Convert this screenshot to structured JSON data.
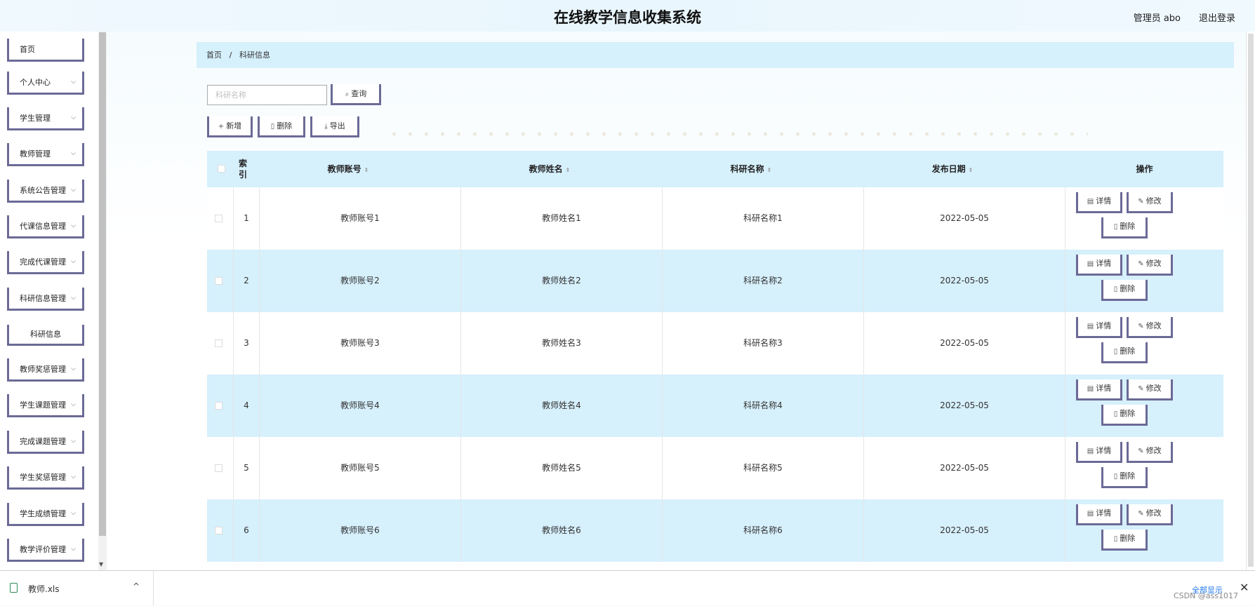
{
  "header": {
    "title": "在线教学信息收集系统",
    "user": "管理员 abo",
    "logout": "退出登录"
  },
  "sidebar": {
    "items": [
      {
        "label": "首页",
        "chevron": ""
      },
      {
        "label": "个人中心",
        "chevron": "⌵"
      },
      {
        "label": "学生管理",
        "chevron": "⌵"
      },
      {
        "label": "教师管理",
        "chevron": "⌵"
      },
      {
        "label": "系统公告管理",
        "chevron": "⌵"
      },
      {
        "label": "代课信息管理",
        "chevron": "⌵"
      },
      {
        "label": "完成代课管理",
        "chevron": "⌵"
      },
      {
        "label": "科研信息管理",
        "chevron": "⌵"
      },
      {
        "label": "科研信息",
        "chevron": ""
      },
      {
        "label": "教师奖惩管理",
        "chevron": "⌵"
      },
      {
        "label": "学生课题管理",
        "chevron": "⌵"
      },
      {
        "label": "完成课题管理",
        "chevron": "⌵"
      },
      {
        "label": "学生奖惩管理",
        "chevron": "⌵"
      },
      {
        "label": "学生成绩管理",
        "chevron": "⌵"
      },
      {
        "label": "教学评价管理",
        "chevron": "⌵"
      }
    ]
  },
  "breadcrumb": {
    "home": "首页",
    "sep": "/",
    "current": "科研信息"
  },
  "search": {
    "placeholder": "科研名称",
    "button": "查询"
  },
  "actions": {
    "add": "新增",
    "delete": "删除",
    "export": "导出"
  },
  "table": {
    "headers": {
      "index": [
        "索",
        "引"
      ],
      "account": "教师账号",
      "name": "教师姓名",
      "research": "科研名称",
      "date": "发布日期",
      "ops": "操作"
    },
    "sort_glyph": "⇕",
    "op_labels": {
      "detail": "详情",
      "edit": "修改",
      "delete": "删除"
    },
    "rows": [
      {
        "index": "1",
        "account": "教师账号1",
        "name": "教师姓名1",
        "research": "科研名称1",
        "date": "2022-05-05"
      },
      {
        "index": "2",
        "account": "教师账号2",
        "name": "教师姓名2",
        "research": "科研名称2",
        "date": "2022-05-05"
      },
      {
        "index": "3",
        "account": "教师账号3",
        "name": "教师姓名3",
        "research": "科研名称3",
        "date": "2022-05-05"
      },
      {
        "index": "4",
        "account": "教师账号4",
        "name": "教师姓名4",
        "research": "科研名称4",
        "date": "2022-05-05"
      },
      {
        "index": "5",
        "account": "教师账号5",
        "name": "教师姓名5",
        "research": "科研名称5",
        "date": "2022-05-05"
      },
      {
        "index": "6",
        "account": "教师账号6",
        "name": "教师姓名6",
        "research": "科研名称6",
        "date": "2022-05-05"
      }
    ]
  },
  "download_bar": {
    "file": "教师.xls",
    "show_all": "全部显示",
    "chevron": "^",
    "close": "✕"
  },
  "watermark": "CSDN @ass1017",
  "icons": {
    "search": "search-icon",
    "add": "plus-icon",
    "delete": "trash-icon",
    "export": "download-icon",
    "detail": "document-icon",
    "edit": "pencil-icon",
    "file": "excel-file-icon"
  },
  "colors": {
    "accent_border": "#6b6a96",
    "light_blue": "#d6f0fc",
    "link_blue": "#1a73e8"
  }
}
